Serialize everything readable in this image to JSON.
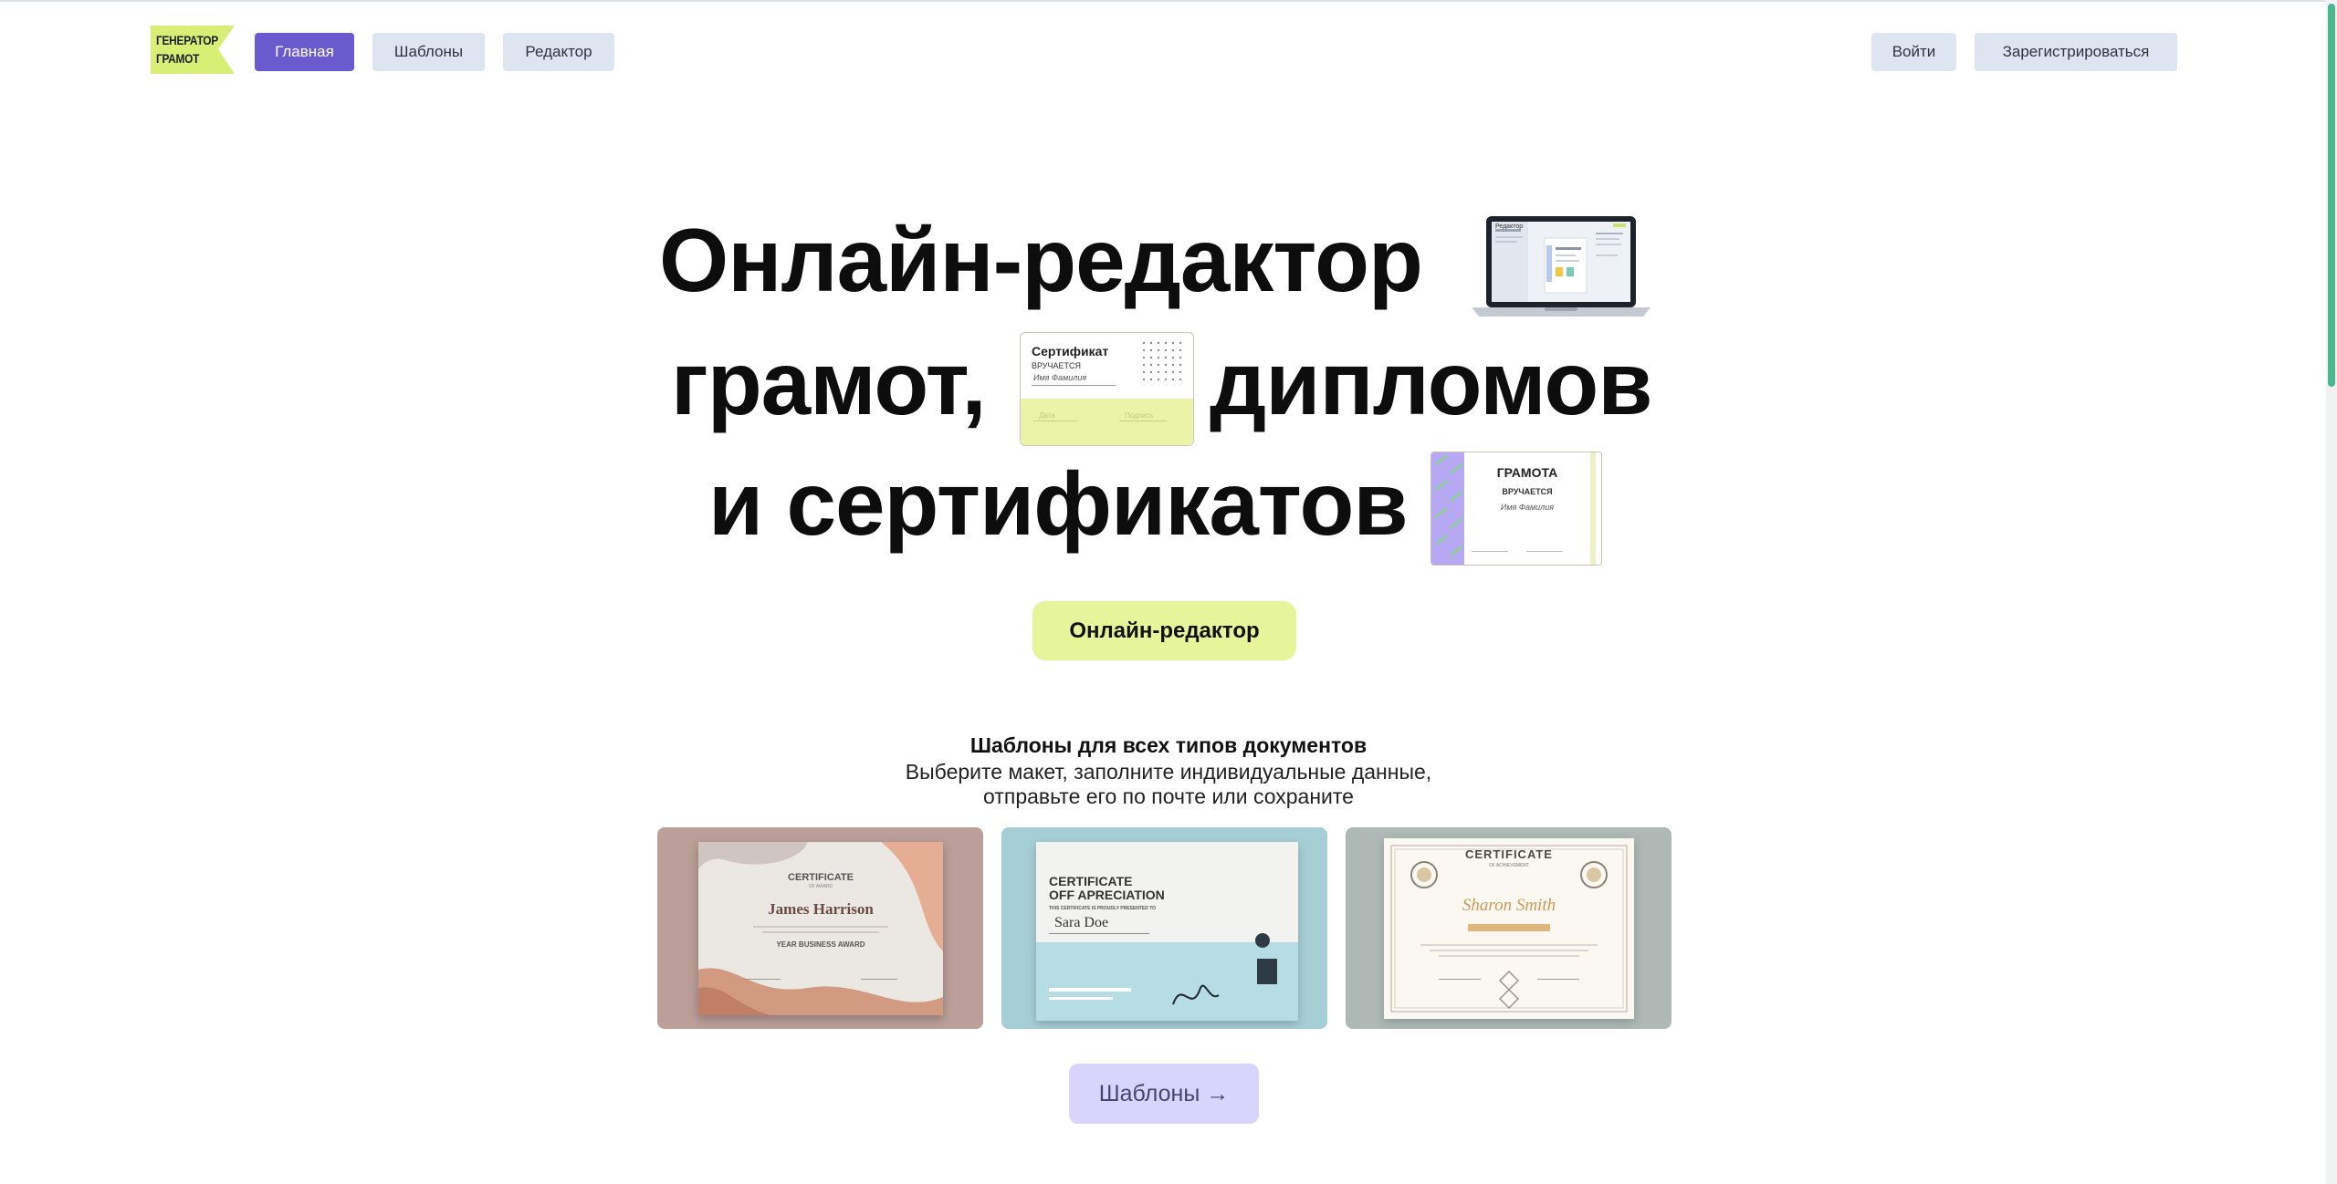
{
  "header": {
    "logo_line1": "ГЕНЕРАТОР",
    "logo_line2": "ГРАМОТ",
    "nav": [
      {
        "label": "Главная"
      },
      {
        "label": "Шаблоны"
      },
      {
        "label": "Редактор"
      }
    ],
    "login_label": "Войти",
    "register_label": "Зарегистрироваться"
  },
  "hero": {
    "line1": "Онлайн-редактор",
    "line2_a": "грамот,",
    "line2_b": "дипломов",
    "line3": "и сертификатов",
    "cert_card": {
      "title": "Сертификат",
      "subtitle": "ВРУЧАЕТСЯ",
      "name": "Имя Фамилия",
      "footer_left": "Дата",
      "footer_right": "Подпись"
    },
    "gramota_card": {
      "title": "ГРАМОТА",
      "subtitle": "ВРУЧАЕТСЯ",
      "name": "Имя Фамилия"
    },
    "laptop_screen_title": "Редактор",
    "cta_label": "Онлайн-редактор"
  },
  "templates": {
    "title": "Шаблоны для всех типов документов",
    "subtitle_line1": "Выберите макет, заполните индивидуальные данные,",
    "subtitle_line2": "отправьте его по почте или сохраните",
    "cards": [
      {
        "heading": "CERTIFICATE",
        "sub": "OF AWARD",
        "name": "James Harrison",
        "award": "YEAR BUSINESS AWARD"
      },
      {
        "heading": "CERTIFICATE",
        "heading2": "OFF APRECIATION",
        "sub": "THIS CERTIFICATE IS PROUDLY PRESENTED TO",
        "name": "Sara Doe"
      },
      {
        "heading": "CERTIFICATE",
        "sub": "OF ACHIEVEMENT",
        "name": "Sharon Smith"
      }
    ],
    "more_label": "Шаблоны →"
  },
  "colors": {
    "accent_purple": "#6a5acd",
    "cta_yellow": "#e6f59a",
    "nav_gray": "#dde6f0",
    "more_lilac": "#d9d4fb"
  }
}
